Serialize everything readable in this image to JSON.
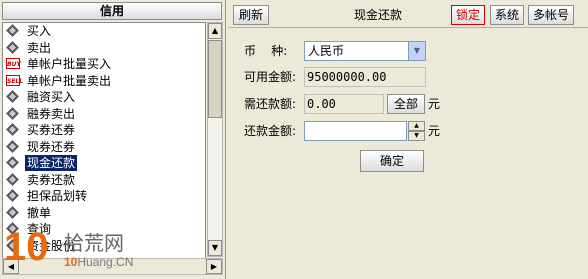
{
  "left_panel": {
    "header": "信用",
    "items": [
      {
        "label": "买入",
        "icon": "diamond-icon"
      },
      {
        "label": "卖出",
        "icon": "diamond-icon"
      },
      {
        "label": "单帐户批量买入",
        "icon": "buy-badge-icon",
        "badge": "BUY"
      },
      {
        "label": "单帐户批量卖出",
        "icon": "sell-badge-icon",
        "badge": "SELL"
      },
      {
        "label": "融资买入",
        "icon": "diamond-icon"
      },
      {
        "label": "融券卖出",
        "icon": "diamond-icon"
      },
      {
        "label": "买券还券",
        "icon": "diamond-icon"
      },
      {
        "label": "现券还券",
        "icon": "diamond-icon"
      },
      {
        "label": "现金还款",
        "icon": "diamond-icon",
        "selected": true
      },
      {
        "label": "卖券还款",
        "icon": "diamond-icon"
      },
      {
        "label": "担保品划转",
        "icon": "diamond-icon"
      },
      {
        "label": "撤单",
        "icon": "diamond-icon"
      },
      {
        "label": "查询",
        "icon": "diamond-icon"
      },
      {
        "label": "资金股份",
        "icon": "diamond-icon"
      }
    ]
  },
  "toolbar": {
    "refresh_label": "刷新",
    "title": "现金还款",
    "lock_label": "锁定",
    "system_label": "系统",
    "multi_account_label": "多帐号"
  },
  "form": {
    "currency_label": "币    种:",
    "currency_value": "人民币",
    "available_label": "可用金额:",
    "available_value": "95000000.00",
    "due_label": "需还款额:",
    "due_value": "0.00",
    "all_button": "全部",
    "unit": "元",
    "repay_label": "还款金额:",
    "repay_value": "",
    "confirm_button": "确定"
  },
  "watermark": {
    "number": "10",
    "chinese": "拾荒网",
    "english_prefix": "10",
    "english_suffix": "Huang.CN"
  },
  "colors": {
    "selection": "#0a246a",
    "lock_red": "#d00000",
    "watermark_orange": "#e86a10"
  }
}
